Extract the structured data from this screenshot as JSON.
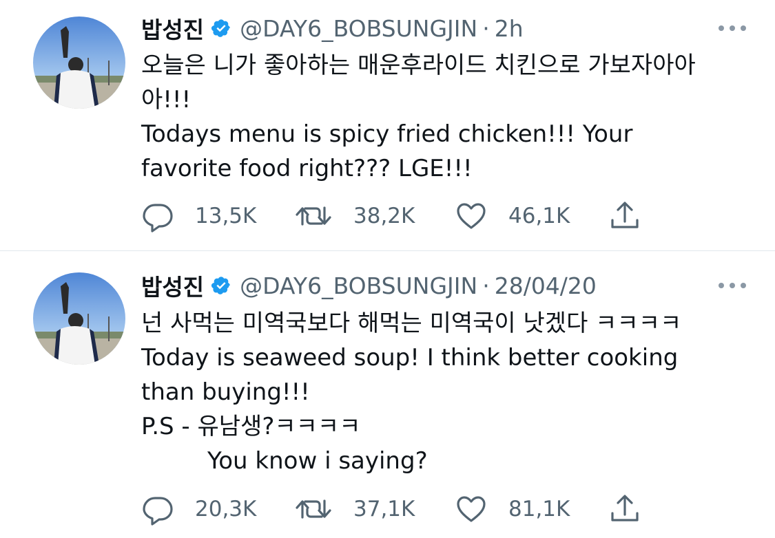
{
  "tweets": [
    {
      "display_name": "밥성진",
      "handle": "@DAY6_BOBSUNGJIN",
      "separator": "·",
      "time": "2h",
      "lines": [
        "오늘은 니가 좋아하는 매운후라이드 치킨으로 가보자아아",
        "아!!!",
        "Todays menu is spicy fried chicken!!! Your",
        "favorite food right??? LGE!!!"
      ],
      "replies": "13,5K",
      "retweets": "38,2K",
      "likes": "46,1K"
    },
    {
      "display_name": "밥성진",
      "handle": "@DAY6_BOBSUNGJIN",
      "separator": "·",
      "time": "28/04/20",
      "lines": [
        "넌 사먹는 미역국보다 해먹는 미역국이 낫겠다 ㅋㅋㅋㅋ",
        "Today is seaweed soup! I think better cooking",
        "than buying!!!",
        "P.S - 유남생?ㅋㅋㅋㅋ",
        "You know i saying?"
      ],
      "replies": "20,3K",
      "retweets": "37,1K",
      "likes": "81,1K"
    }
  ],
  "icons": {
    "verified": "verified-badge-icon",
    "more": "more-dots-icon",
    "reply": "reply-bubble-icon",
    "retweet": "retweet-icon",
    "like": "heart-icon",
    "share": "share-icon"
  },
  "colors": {
    "text": "#0f1419",
    "secondary": "#536471",
    "verified": "#1d9bf0",
    "divider": "#e1e8ed"
  }
}
